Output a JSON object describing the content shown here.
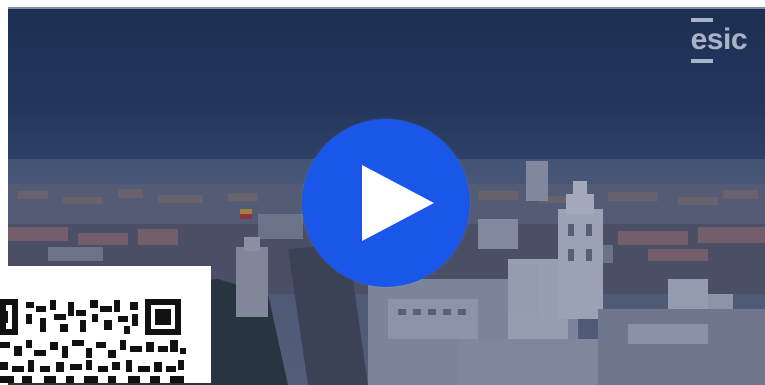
{
  "video": {
    "brand_logo_text": "esic",
    "play_icon": "play-icon",
    "accent_color": "#1a56e8"
  },
  "qr": {
    "icon": "qr-code-icon"
  }
}
